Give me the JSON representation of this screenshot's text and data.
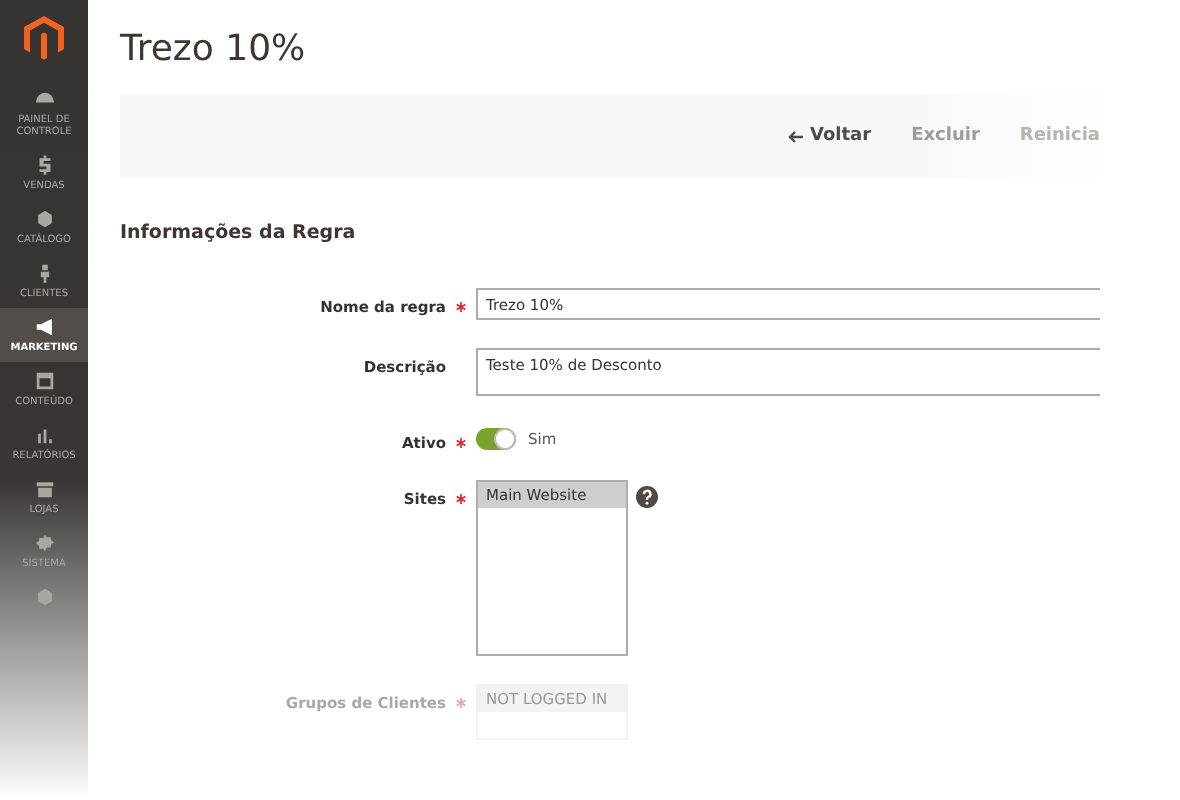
{
  "sidebar": {
    "items": [
      {
        "label": "PAINEL DE CONTROLE",
        "selected": false
      },
      {
        "label": "VENDAS",
        "selected": false
      },
      {
        "label": "CATÁLOGO",
        "selected": false
      },
      {
        "label": "CLIENTES",
        "selected": false
      },
      {
        "label": "MARKETING",
        "selected": true
      },
      {
        "label": "CONTEÚDO",
        "selected": false
      },
      {
        "label": "RELATÓRIOS",
        "selected": false
      },
      {
        "label": "LOJAS",
        "selected": false
      },
      {
        "label": "SISTEMA",
        "selected": false
      },
      {
        "selected": false
      }
    ]
  },
  "page": {
    "title": "Trezo 10%"
  },
  "actions": [
    {
      "label": "Voltar",
      "kind": "back"
    },
    {
      "label": "Excluir",
      "kind": "plain"
    },
    {
      "label": "Reinicia",
      "kind": "faded"
    }
  ],
  "section": {
    "title": "Informações da Regra"
  },
  "fields": [
    {
      "kind": "input",
      "label": "Nome da regra",
      "required": true,
      "value": "Trezo 10%"
    },
    {
      "kind": "textarea",
      "label": "Descrição",
      "required": false,
      "value": "Teste 10% de Desconto"
    },
    {
      "kind": "toggle",
      "label": "Ativo",
      "required": true,
      "on": true,
      "value": "Sim"
    },
    {
      "kind": "multiselect",
      "label": "Sites",
      "required": true,
      "options": [
        {
          "label": "Main Website",
          "selected": true
        }
      ]
    },
    {
      "kind": "faded",
      "label": "Grupos de Clientes",
      "required": true,
      "options": [
        {
          "label": "NOT LOGGED IN",
          "selected": true
        }
      ]
    }
  ]
}
